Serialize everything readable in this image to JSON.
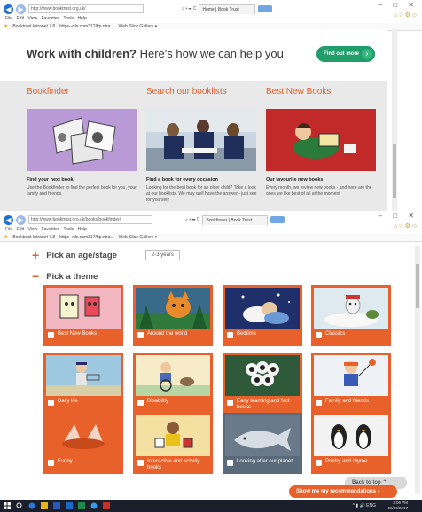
{
  "shot1": {
    "browser": {
      "url": "http://www.booktrust.org.uk/",
      "search_tools": "⌕ ▾ ☰ C",
      "tab_title": "Home | Book Trust",
      "menu": [
        "File",
        "Edit",
        "View",
        "Favorites",
        "Tools",
        "Help"
      ],
      "favorites": [
        "Booktrust Intranet 7.8",
        "https--rdx.com317/ftp.ntra...",
        "Web Slice Gallery ▾"
      ]
    },
    "banner": {
      "headline_bold": "Work with children?",
      "headline_rest": " Here's how we can help you",
      "button_label": "Find out more"
    },
    "columns": [
      {
        "heading": "Bookfinder",
        "link": "Find your next book",
        "desc": "Use the Bookfinder to find the perfect book for you, your family and friends."
      },
      {
        "heading": "Search our booklists",
        "link": "Find a book for every occasion",
        "desc": "Looking for the best book for an older child? Take a look at our booklists. We may well have the answer - just see for yourself!"
      },
      {
        "heading": "Best New Books",
        "link": "Our favourite new books",
        "desc": "Every month, we review new books - and here are the ones we like best of all at the moment"
      }
    ]
  },
  "shot2": {
    "browser": {
      "url": "http://www.booktrust.org.uk/books/bookfinder/",
      "search_tools": "⌕ ▾ ☰ C",
      "tab_title": "Bookfinder | Book Trust",
      "menu": [
        "File",
        "Edit",
        "View",
        "Favorites",
        "Tools",
        "Help"
      ],
      "favorites": [
        "Booktrust Intranet 7.8",
        "https--rdx.com317/ftp.ntra...",
        "Web Slice Gallery ▾"
      ]
    },
    "age": {
      "label": "Pick an age/stage",
      "value": "2-3 years"
    },
    "theme_label": "Pick a theme",
    "themes": [
      "Best New Books",
      "Around the world",
      "Bedtime",
      "Classics",
      "Daily life",
      "Disability",
      "Early learning and fact books",
      "Family and friends",
      "Funny",
      "Interactive and activity books",
      "Looking after our planet",
      "Poetry and rhyme"
    ],
    "back_to_top": "Back to top",
    "recommend_button": "Show me my recommendations",
    "taskbar": {
      "time": "3:06 PM",
      "date": "02/16/2017",
      "lang": "ENG"
    }
  },
  "colors": {
    "brand_orange": "#e8612a",
    "green_button": "#1f9e6a"
  }
}
